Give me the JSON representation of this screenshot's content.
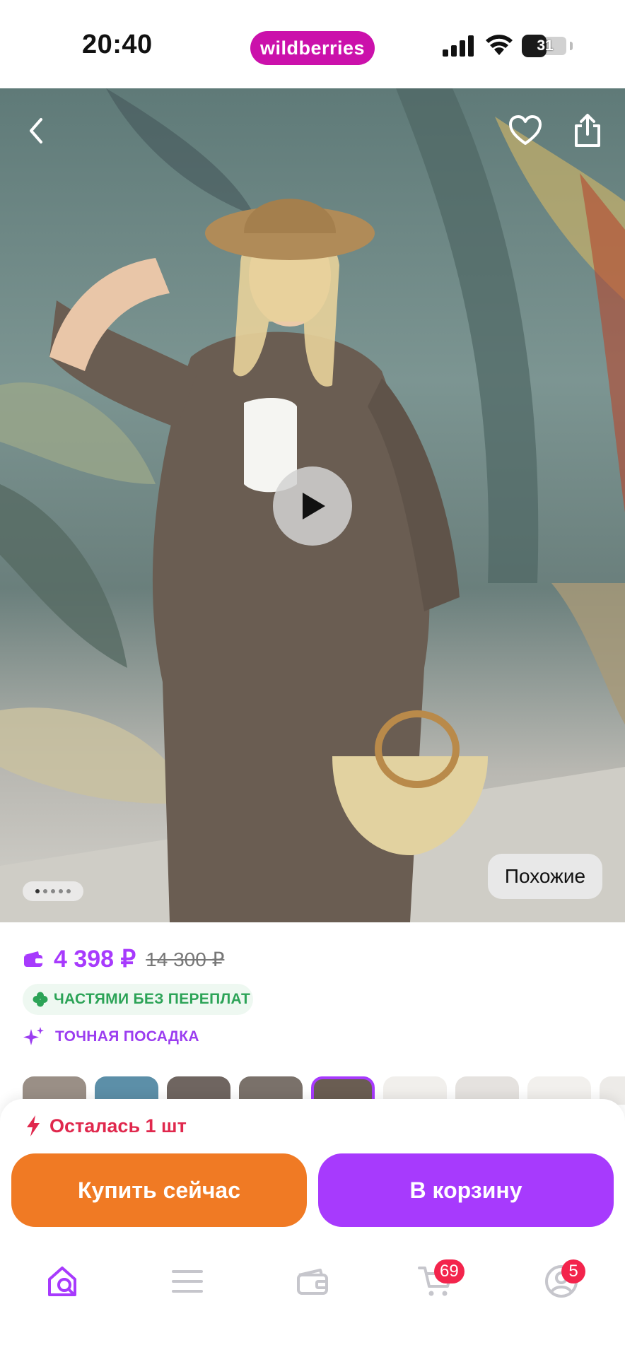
{
  "status_bar": {
    "time": "20:40",
    "brand": "wildberries",
    "battery": "31",
    "battery_level": 0.31
  },
  "hero": {
    "similar_label": "Похожие",
    "gallery_dots": 5,
    "gallery_active": 0
  },
  "product": {
    "price": "4 398 ₽",
    "old_price": "14 300 ₽",
    "installments": "ЧАСТЯМИ БЕЗ ПЕРЕПЛАТ",
    "fit": "ТОЧНАЯ ПОСАДКА"
  },
  "stock": {
    "label": "Осталась 1 шт"
  },
  "actions": {
    "buy_now": "Купить сейчас",
    "add_to_cart": "В корзину"
  },
  "tabbar": {
    "cart_badge": "69",
    "profile_badge": "5"
  },
  "colors": {
    "brand": "#cb11ab",
    "accent": "#a73afd",
    "buy_now": "#f07a24",
    "stock": "#e0284d",
    "installments": "#2ca357",
    "badge": "#f3244c"
  },
  "icons": [
    "back-icon",
    "heart-icon",
    "share-icon",
    "play-icon",
    "wallet-icon",
    "clover-icon",
    "sparkle-icon",
    "lightning-icon",
    "home-search-icon",
    "menu-icon",
    "wallet-tab-icon",
    "cart-icon",
    "profile-icon"
  ]
}
